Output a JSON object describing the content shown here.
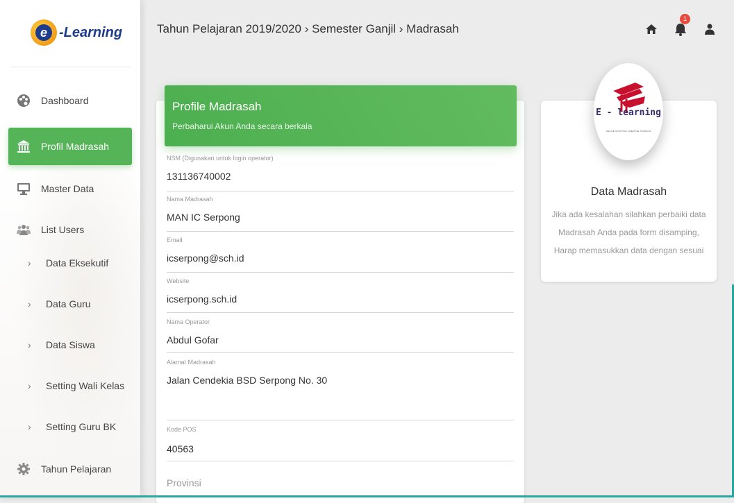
{
  "app": {
    "logo_letter": "e",
    "logo_text": "-Learning"
  },
  "breadcrumb": {
    "year": "Tahun Pelajaran 2019/2020",
    "separator": "›",
    "semester": "Semester Ganjil",
    "page": "Madrasah"
  },
  "top_icons": {
    "home": "home-icon",
    "notifications": "bell-icon",
    "notification_count": "1",
    "user": "user-icon"
  },
  "sidebar": {
    "items": [
      {
        "label": "Dashboard",
        "icon": "palette-icon"
      },
      {
        "label": "Profil Madrasah",
        "icon": "bank-icon",
        "active": true
      },
      {
        "label": "Master Data",
        "icon": "monitor-icon"
      },
      {
        "label": "List Users",
        "icon": "users-icon"
      }
    ],
    "sub_items": [
      {
        "label": "Data Eksekutif"
      },
      {
        "label": "Data Guru"
      },
      {
        "label": "Data Siswa"
      },
      {
        "label": "Setting Wali Kelas"
      },
      {
        "label": "Setting Guru BK"
      }
    ],
    "footer_item": {
      "label": "Tahun Pelajaran",
      "icon": "gear-icon"
    }
  },
  "profile_card": {
    "title": "Profile Madrasah",
    "subtitle": "Perbaharui Akun Anda secara berkala",
    "fields": [
      {
        "label": "NSM (Digunakan untuk login operator)",
        "value": "131136740002"
      },
      {
        "label": "Nama Madrasah",
        "value": "MAN IC Serpong"
      },
      {
        "label": "Email",
        "value": "icserpong@sch.id"
      },
      {
        "label": "Website",
        "value": "icserpong.sch.id"
      },
      {
        "label": "Nama Operator",
        "value": "Abdul Gofar"
      },
      {
        "label": "Alamat Madrasah",
        "value": "Jalan Cendekia BSD Serpong No. 30"
      },
      {
        "label": "Kode POS",
        "value": "40563"
      },
      {
        "label": "",
        "placeholder": "Provinsi"
      }
    ]
  },
  "side_card": {
    "logo_text": "E - learning",
    "logo_tagline": "ONLINE STUDYING CREATIVE THINKING",
    "title": "Data Madrasah",
    "description": "Jika ada kesalahan silahkan perbaiki data Madrasah Anda pada form disamping, Harap memasukkan data dengan sesuai"
  },
  "colors": {
    "accent_green": "#4caf50",
    "brand_blue": "#1e3c8c",
    "notification_red": "#e84a3c",
    "logo_red": "#c8102e"
  }
}
